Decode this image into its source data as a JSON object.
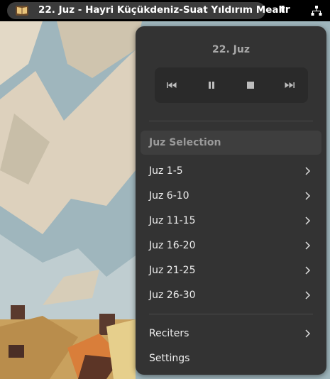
{
  "topbar": {
    "app_title": "22. Juz - Hayri Küçükdeniz-Suat Yıldırım Meali",
    "app_icon": "open-book-icon",
    "language": "tr",
    "network_icon": "network-wired-icon"
  },
  "menu": {
    "title": "22. Juz",
    "controls": {
      "previous": "skip-previous-icon",
      "pause": "pause-icon",
      "stop": "stop-icon",
      "next": "skip-next-icon"
    },
    "section_header": "Juz Selection",
    "juz_items": [
      {
        "label": "Juz 1-5"
      },
      {
        "label": "Juz 6-10"
      },
      {
        "label": "Juz 11-15"
      },
      {
        "label": "Juz 16-20"
      },
      {
        "label": "Juz 21-25"
      },
      {
        "label": "Juz 26-30"
      }
    ],
    "reciters_label": "Reciters",
    "settings_label": "Settings"
  },
  "colors": {
    "menu_bg": "#333333",
    "topbar_bg": "#000000",
    "pill_bg": "#3b3b3b",
    "controls_bg": "#2a2a2a"
  }
}
